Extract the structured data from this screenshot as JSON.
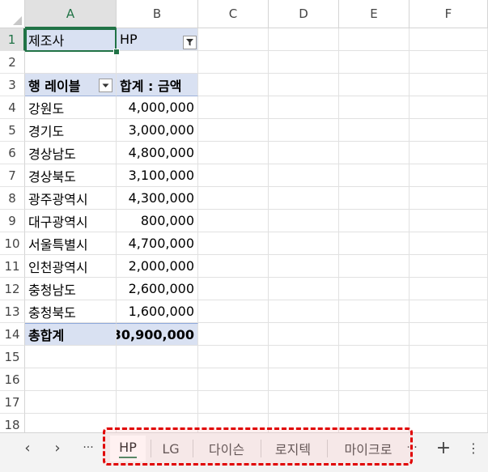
{
  "columns": [
    "A",
    "B",
    "C",
    "D",
    "E",
    "F"
  ],
  "rows": [
    "1",
    "2",
    "3",
    "4",
    "5",
    "6",
    "7",
    "8",
    "9",
    "10",
    "11",
    "12",
    "13",
    "14",
    "15",
    "16",
    "17",
    "18"
  ],
  "filter": {
    "label": "제조사",
    "value": "HP"
  },
  "pivot_header": {
    "row_labels": "행 레이블",
    "sum_label": "합계 : 금액"
  },
  "pivot_rows": [
    {
      "region": "강원도",
      "amount": "4,000,000"
    },
    {
      "region": "경기도",
      "amount": "3,000,000"
    },
    {
      "region": "경상남도",
      "amount": "4,800,000"
    },
    {
      "region": "경상북도",
      "amount": "3,100,000"
    },
    {
      "region": "광주광역시",
      "amount": "4,300,000"
    },
    {
      "region": "대구광역시",
      "amount": "800,000"
    },
    {
      "region": "서울특별시",
      "amount": "4,700,000"
    },
    {
      "region": "인천광역시",
      "amount": "2,000,000"
    },
    {
      "region": "충청남도",
      "amount": "2,600,000"
    },
    {
      "region": "충청북도",
      "amount": "1,600,000"
    }
  ],
  "grand_total": {
    "label": "총합계",
    "amount": "30,900,000"
  },
  "sheet_tabs": [
    "HP",
    "LG",
    "다이슨",
    "로지텍",
    "마이크로"
  ],
  "active_tab": "HP",
  "nav": {
    "prev": "‹",
    "next": "›",
    "more_left": "···",
    "more_right": "···",
    "add": "+",
    "menu": "⋮"
  },
  "colors": {
    "accent": "#217346",
    "pivot_header_bg": "#d9e1f2",
    "highlight_border": "#e00000"
  }
}
